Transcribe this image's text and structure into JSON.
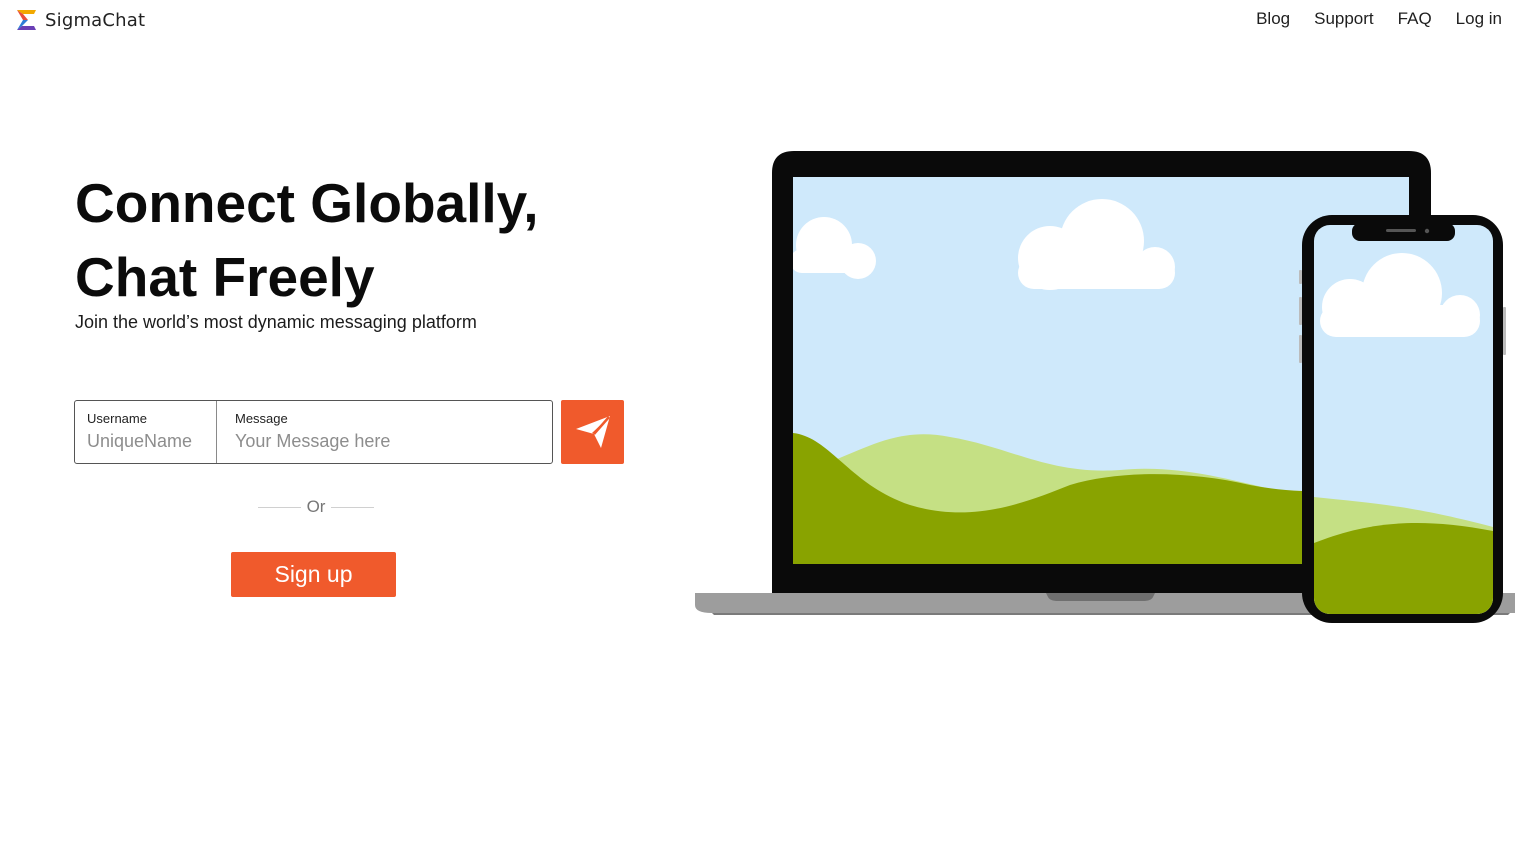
{
  "header": {
    "brand_name": "SigmaChat",
    "nav": {
      "blog": "Blog",
      "support": "Support",
      "faq": "FAQ",
      "login": "Log in"
    }
  },
  "hero": {
    "title_line1": "Connect Globally,",
    "title_line2": "Chat Freely",
    "subtitle": "Join the world’s most dynamic messaging platform"
  },
  "form": {
    "username_label": "Username",
    "username_placeholder": "UniqueName",
    "message_label": "Message",
    "message_placeholder": "Your Message here",
    "send_icon": "paper-plane-icon",
    "divider_text": "Or",
    "signup_label": "Sign up"
  },
  "colors": {
    "accent": "#f05a2c",
    "sky": "#cfe9fb",
    "hill_dark": "#89a300",
    "hill_light": "#c5e084"
  }
}
